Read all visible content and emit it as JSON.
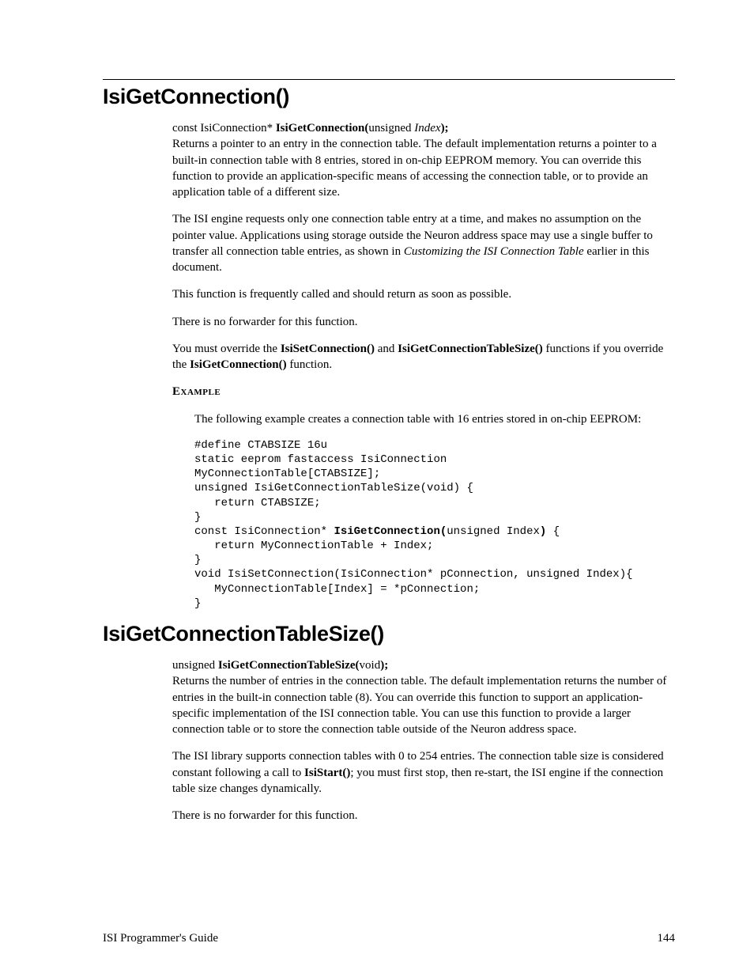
{
  "section1": {
    "heading": "IsiGetConnection()",
    "signature": {
      "pre": "const IsiConnection* ",
      "name": "IsiGetConnection(",
      "mid": "unsigned ",
      "param": "Index",
      "post": ");"
    },
    "para1a": "Returns a pointer to an entry in the connection table.  The default implementation returns a pointer to a built-in connection table with 8 entries, stored in on-chip EEPROM memory.  You can override this function to provide an application-specific means of accessing the connection table, or to provide an application table of a different size.",
    "para2a": "The ISI engine requests only one connection table entry at a time, and makes no assumption on the pointer value.  Applications using storage outside the Neuron address space may use a single buffer to transfer all connection table entries, as shown in ",
    "para2b_italic": "Customizing the ISI Connection Table",
    "para2c": " earlier in this document.",
    "para3": "This function is frequently called and should return as soon as possible.",
    "para4": "There is no forwarder for this function.",
    "para5a": "You must override the ",
    "para5b_bold": "IsiSetConnection()",
    "para5c": " and ",
    "para5d_bold": "IsiGetConnectionTableSize()",
    "para5e": " functions if you override the ",
    "para5f_bold": "IsiGetConnection()",
    "para5g": " function.",
    "example_label": "Example",
    "example_intro": "The following example creates a connection table with 16 entries stored in on-chip EEPROM:",
    "code_lines": [
      "#define CTABSIZE 16u",
      "static eeprom fastaccess IsiConnection",
      "MyConnectionTable[CTABSIZE];",
      "unsigned IsiGetConnectionTableSize(void) {",
      "   return CTABSIZE;",
      "}",
      "const IsiConnection* |IsiGetConnection(|unsigned Index|)| {",
      "   return MyConnectionTable + Index;",
      "}",
      "void IsiSetConnection(IsiConnection* pConnection, unsigned Index){",
      "   MyConnectionTable[Index] = *pConnection;",
      "}"
    ]
  },
  "section2": {
    "heading": "IsiGetConnectionTableSize()",
    "signature": {
      "pre": "unsigned ",
      "name": "IsiGetConnectionTableSize(",
      "mid": "void",
      "post": ");"
    },
    "para1": "Returns the number of entries in the connection table.  The default implementation returns the number of entries in the built-in connection table (8). You can override this function to support an application-specific implementation of the ISI connection table. You can use this function to provide a larger connection table or to store the connection table outside of the Neuron address space.",
    "para2a": "The ISI library supports connection tables with 0 to 254 entries.  The connection table size is considered constant following a call to ",
    "para2b_bold": "IsiStart()",
    "para2c": "; you must first stop, then re-start, the ISI engine if the connection table size changes dynamically.",
    "para3": "There is no forwarder for this function."
  },
  "footer": {
    "left": "ISI Programmer's Guide",
    "right": "144"
  }
}
